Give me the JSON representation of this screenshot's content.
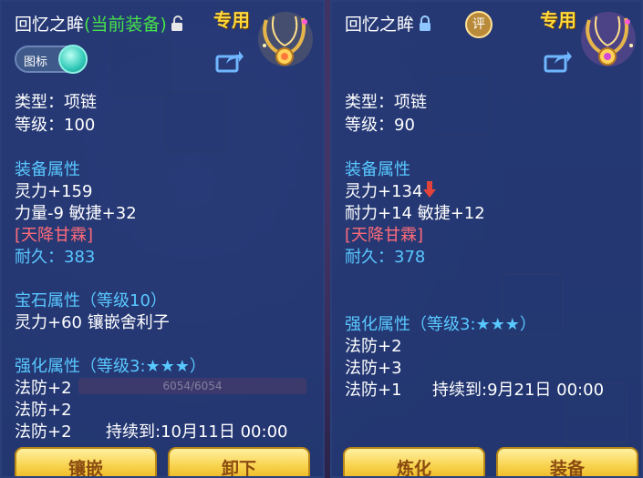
{
  "left": {
    "name": "回忆之眸",
    "current_tag": "(当前装备)",
    "exclusive": "专用",
    "icon_toggle_label": "图标",
    "type_line": "类型：项链",
    "level_line": "等级：100",
    "equip_attr_title": "装备属性",
    "attrs": [
      "灵力+159",
      "力量-9 敏捷+32"
    ],
    "set_name": "[天降甘霖]",
    "durability_label": "耐久：",
    "durability_value": "383",
    "gem_title": "宝石属性（等级10）",
    "gem_line": "灵力+60 镶嵌舍利子",
    "enhance_title": "强化属性（等级3:★★★）",
    "enhance_lines": [
      "法防+2",
      "法防+2"
    ],
    "enhance_last": "法防+2",
    "duration": "持续到:10月11日 00:00",
    "bg_bar_text": "6054/6054",
    "buttons": [
      "镶嵌",
      "卸下"
    ]
  },
  "right": {
    "name": "回忆之眸",
    "rate_badge": "评",
    "exclusive": "专用",
    "type_line": "类型：项链",
    "level_line": "等级：90",
    "equip_attr_title": "装备属性",
    "attrs": [
      "灵力+134",
      "耐力+14 敏捷+12"
    ],
    "set_name": "[天降甘霖]",
    "durability_label": "耐久：",
    "durability_value": "378",
    "enhance_title": "强化属性（等级3:★★★）",
    "enhance_lines": [
      "法防+2",
      "法防+3"
    ],
    "enhance_last": "法防+1",
    "duration": "持续到:9月21日 00:00",
    "buttons": [
      "炼化",
      "装备"
    ]
  },
  "colors": {
    "panel_bg": "#213a78",
    "attr_heading": "#59c8ff",
    "set_name": "#ff6b7a",
    "current_tag": "#46e24a",
    "exclusive": "#ffd93a",
    "button": "#f8d14a",
    "button_text": "#8a4b10"
  },
  "icons": [
    "unlocked-padlock-icon",
    "locked-padlock-icon",
    "share-icon",
    "necklace-item-icon",
    "stat-down-arrow-icon",
    "toggle-knob-icon"
  ]
}
